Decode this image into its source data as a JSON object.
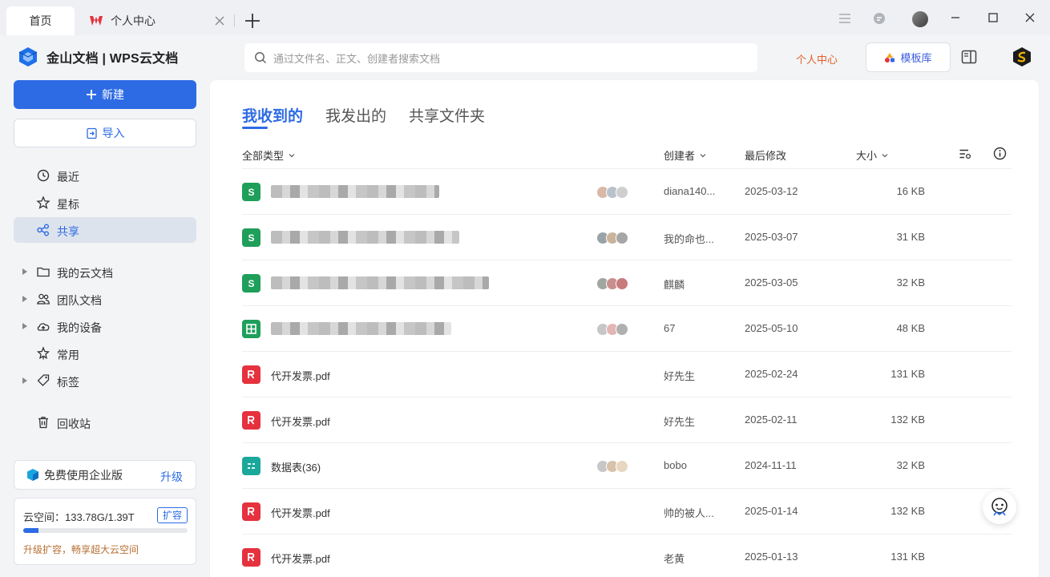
{
  "tabs": {
    "home": "首页",
    "personal": "个人中心"
  },
  "brand": {
    "name": "金山文档 | WPS云文档"
  },
  "search": {
    "placeholder": "通过文件名、正文、创建者搜索文档"
  },
  "header": {
    "personal_link": "个人中心",
    "template_label": "模板库"
  },
  "sidebar": {
    "new_label": "新建",
    "import_label": "导入",
    "nav": [
      {
        "label": "最近",
        "icon": "clock-icon"
      },
      {
        "label": "星标",
        "icon": "star-icon"
      },
      {
        "label": "共享",
        "icon": "share-icon",
        "active": true
      }
    ],
    "tree": [
      {
        "label": "我的云文档",
        "icon": "folder-icon",
        "expandable": true
      },
      {
        "label": "团队文档",
        "icon": "team-icon",
        "expandable": true
      },
      {
        "label": "我的设备",
        "icon": "cloud-device-icon",
        "expandable": true
      },
      {
        "label": "常用",
        "icon": "pin-icon",
        "expandable": false
      },
      {
        "label": "标签",
        "icon": "tag-icon",
        "expandable": true
      }
    ],
    "trash_label": "回收站",
    "promo": {
      "label": "免费使用企业版",
      "upgrade": "升级"
    },
    "storage": {
      "text": "云空间：133.78G/1.39T",
      "expand": "扩容",
      "used_fraction": 0.094,
      "upsell": "升级扩容，畅享超大云空间"
    }
  },
  "main": {
    "tabs": [
      "我收到的",
      "我发出的",
      "共享文件夹"
    ],
    "active_tab": 0,
    "columns": {
      "type": "全部类型",
      "creator": "创建者",
      "modified": "最后修改",
      "size": "大小"
    },
    "rows": [
      {
        "type": "sheet-s",
        "name": "",
        "blurred": true,
        "avatars": 3,
        "creator": "diana140...",
        "date": "2025-03-12",
        "size": "16 KB"
      },
      {
        "type": "sheet-s",
        "name": "",
        "blurred": true,
        "avatars": 3,
        "creator": "我的命也...",
        "date": "2025-03-07",
        "size": "31 KB"
      },
      {
        "type": "sheet-s",
        "name": "",
        "blurred": true,
        "avatars": 3,
        "creator": "麒麟",
        "date": "2025-03-05",
        "size": "32 KB"
      },
      {
        "type": "sheet-grid",
        "name": "",
        "blurred": true,
        "avatars": 3,
        "creator": "67",
        "date": "2025-05-10",
        "size": "48 KB"
      },
      {
        "type": "pdf",
        "name": "代开发票.pdf",
        "blurred": false,
        "avatars": 0,
        "creator": "好先生",
        "date": "2025-02-24",
        "size": "131 KB"
      },
      {
        "type": "pdf",
        "name": "代开发票.pdf",
        "blurred": false,
        "avatars": 0,
        "creator": "好先生",
        "date": "2025-02-11",
        "size": "132 KB"
      },
      {
        "type": "datatable",
        "name": "数据表(36)",
        "blurred": false,
        "avatars": 3,
        "creator": "bobo",
        "date": "2024-11-11",
        "size": "32 KB"
      },
      {
        "type": "pdf",
        "name": "代开发票.pdf",
        "blurred": false,
        "avatars": 0,
        "creator": "帅的被人...",
        "date": "2025-01-14",
        "size": "132 KB"
      },
      {
        "type": "pdf",
        "name": "代开发票.pdf",
        "blurred": false,
        "avatars": 0,
        "creator": "老黄",
        "date": "2025-01-13",
        "size": "131 KB"
      }
    ]
  },
  "colors": {
    "accent": "#2d6be4",
    "sheet": "#1f9f5a",
    "pdf": "#e5323e",
    "datatable": "#1aa89b",
    "orange": "#e1612a"
  }
}
